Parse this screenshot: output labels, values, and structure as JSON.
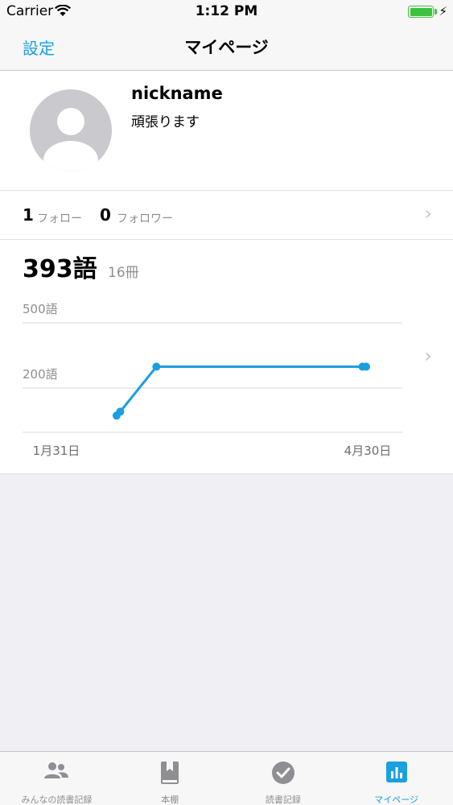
{
  "status_bar": {
    "carrier": "Carrier",
    "time": "1:12 PM",
    "battery_level": 1.0
  },
  "nav": {
    "left_button": "設定",
    "title": "マイページ"
  },
  "profile": {
    "nickname": "nickname",
    "bio": "頑張ります",
    "following_count": "1",
    "following_label": "フォロー",
    "followers_count": "0",
    "followers_label": "フォロワー"
  },
  "stats": {
    "words": "393語",
    "books": "16冊"
  },
  "chart_data": {
    "type": "line",
    "series": [
      {
        "name": "",
        "points": [
          {
            "x": "2017-02-20",
            "y": 73
          },
          {
            "x": "2017-02-21",
            "y": 91
          },
          {
            "x": "2017-03-03",
            "y": 298
          },
          {
            "x": "2017-04-29",
            "y": 298
          },
          {
            "x": "2017-04-30",
            "y": 298
          }
        ]
      }
    ],
    "x_range": [
      "2017-01-31",
      "2017-04-30"
    ],
    "ylim": [
      0,
      500
    ],
    "y_gridlines": [
      500,
      200
    ],
    "y_tick_labels": [
      "500語",
      "200語"
    ],
    "x_tick_labels": [
      "1月31日",
      "4月30日"
    ],
    "color": "#1a9fe0"
  },
  "tabs": [
    {
      "label": "みんなの読書記録",
      "icon": "people-icon",
      "active": false
    },
    {
      "label": "本棚",
      "icon": "book-icon",
      "active": false
    },
    {
      "label": "読書記録",
      "icon": "check-circle-icon",
      "active": false
    },
    {
      "label": "マイページ",
      "icon": "bar-chart-icon",
      "active": true
    }
  ],
  "colors": {
    "accent": "#1a9fe0",
    "battery": "#3ec13e"
  }
}
